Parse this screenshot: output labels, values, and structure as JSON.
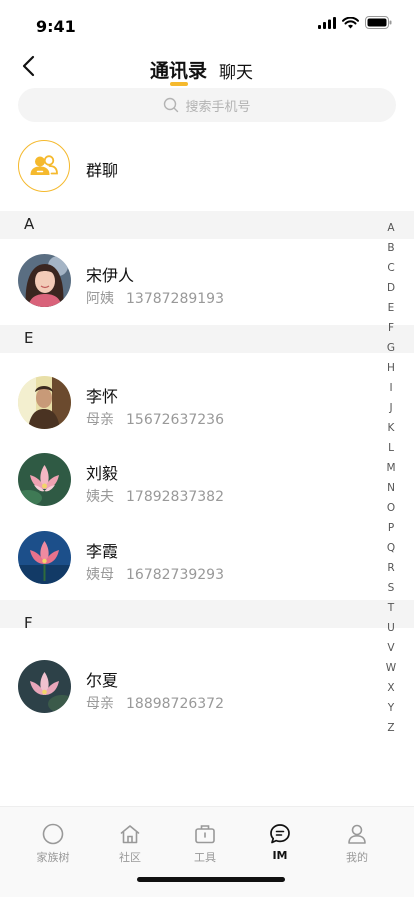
{
  "status_bar": {
    "time": "9:41"
  },
  "header": {
    "tab_active": "通讯录",
    "tab_chat": "聊天"
  },
  "search": {
    "placeholder": "搜索手机号"
  },
  "group": {
    "label": "群聊"
  },
  "sections": [
    {
      "letter": "A",
      "contacts": [
        {
          "name": "宋伊人",
          "relation": "阿姨",
          "phone": "13787289193",
          "avatar": "portrait-woman"
        }
      ]
    },
    {
      "letter": "E",
      "contacts": [
        {
          "name": "李怀",
          "relation": "母亲",
          "phone": "15672637236",
          "avatar": "portrait-man"
        },
        {
          "name": "刘毅",
          "relation": "姨夫",
          "phone": "17892837382",
          "avatar": "lotus-green"
        },
        {
          "name": "李霞",
          "relation": "姨母",
          "phone": "16782739293",
          "avatar": "lotus-blue"
        }
      ]
    },
    {
      "letter": "F",
      "contacts": [
        {
          "name": "尔夏",
          "relation": "母亲",
          "phone": "18898726372",
          "avatar": "lotus-dark"
        }
      ]
    }
  ],
  "alphabet": [
    "A",
    "B",
    "C",
    "D",
    "E",
    "F",
    "G",
    "H",
    "I",
    "J",
    "K",
    "L",
    "M",
    "N",
    "O",
    "P",
    "Q",
    "R",
    "S",
    "T",
    "U",
    "V",
    "W",
    "X",
    "Y",
    "Z"
  ],
  "tabbar": {
    "items": [
      {
        "label": "家族树",
        "icon": "family-tree-icon"
      },
      {
        "label": "社区",
        "icon": "community-icon"
      },
      {
        "label": "工具",
        "icon": "tools-icon"
      },
      {
        "label": "IM",
        "icon": "chat-icon",
        "active": true
      },
      {
        "label": "我的",
        "icon": "profile-icon"
      }
    ]
  },
  "colors": {
    "accent": "#F5B92D",
    "section_bg": "#F4F4F4",
    "muted_text": "#999999"
  }
}
